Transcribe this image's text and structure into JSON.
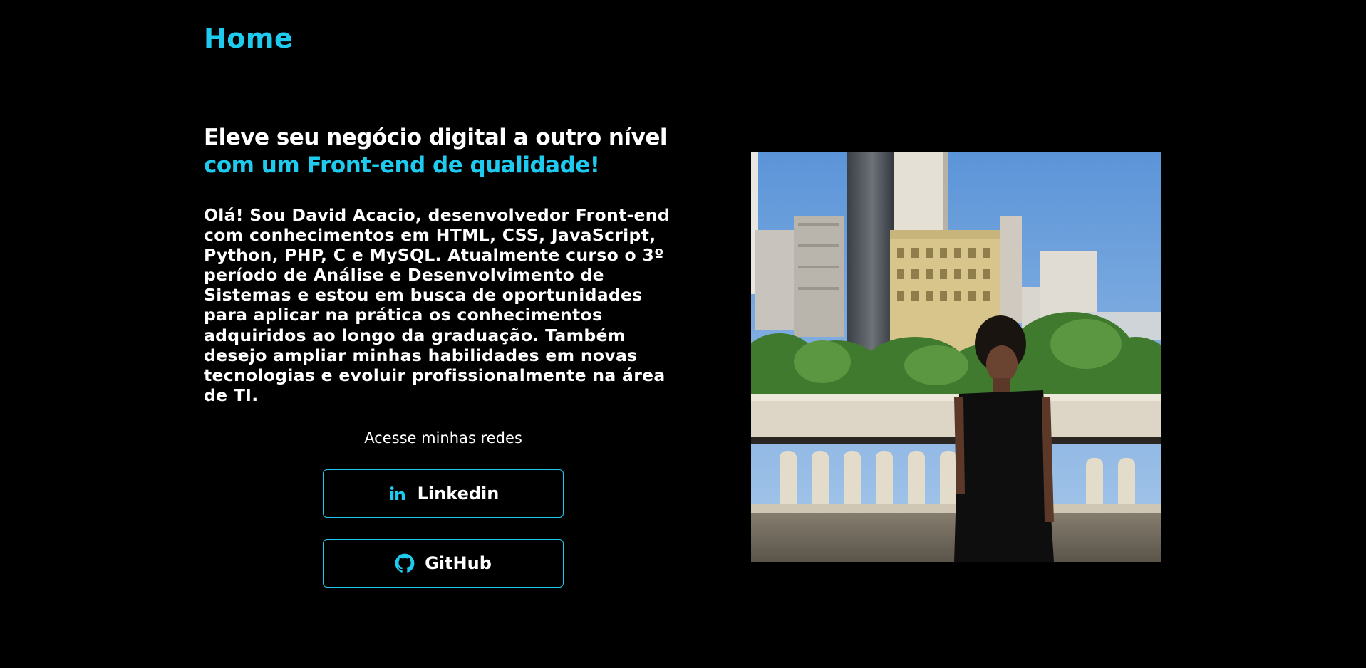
{
  "nav": {
    "title": "Home"
  },
  "hero": {
    "headline_line1": "Eleve seu negócio digital a outro nível",
    "headline_line2": "com um Front-end de qualidade!",
    "bio": "Olá! Sou David Acacio, desenvolvedor Front-end com conhecimentos em HTML, CSS, JavaScript, Python, PHP, C e MySQL. Atualmente curso o 3º período de Análise e Desenvolvimento de Sistemas e estou em busca de oportunidades para aplicar na prática os conhecimentos adquiridos ao longo da graduação. Também desejo ampliar minhas habilidades em novas tecnologias e evoluir profissionalmente na área de TI."
  },
  "social": {
    "label": "Acesse minhas redes",
    "linkedin_label": "Linkedin",
    "github_label": "GitHub",
    "linkedin_icon": "linkedin-icon",
    "github_icon": "github-icon"
  },
  "colors": {
    "accent": "#1ecbef",
    "background": "#000000",
    "text": "#ffffff"
  }
}
